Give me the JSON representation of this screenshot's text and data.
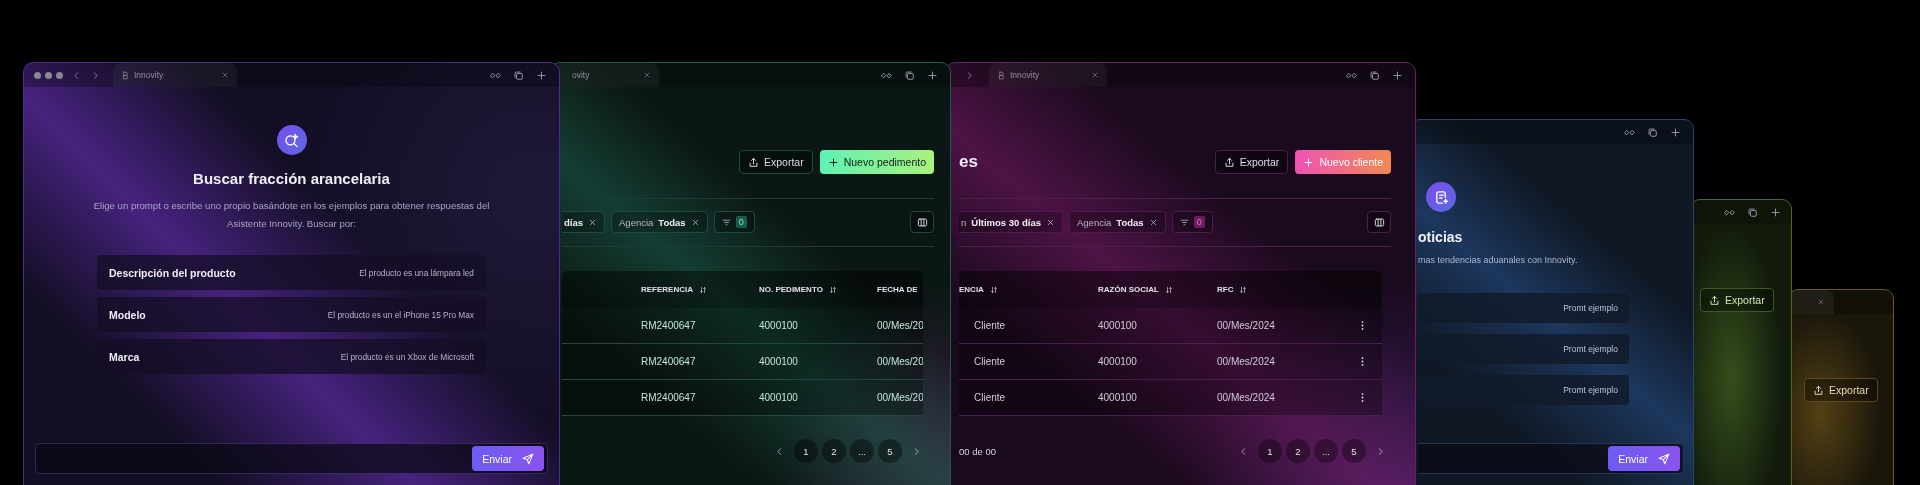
{
  "search_window": {
    "tab": {
      "label": "Innovity"
    },
    "title": "Buscar fracción arancelaria",
    "description": "Elige un prompt o escribe uno propio basándote en los ejemplos para obtener respuestas del Asistente Innovity. Buscar por:",
    "prompts": [
      {
        "label": "Descripción del producto",
        "example": "El producto es una lámpara led"
      },
      {
        "label": "Modelo",
        "example": "El producto es un el iPhone 15 Pro Max"
      },
      {
        "label": "Marca",
        "example": "El producto es un Xbox de Microsoft"
      }
    ],
    "send_button": "Enviar"
  },
  "orders_window": {
    "tab": {
      "label": "ovity"
    },
    "export_button": "Exportar",
    "create_button": "Nuevo pedimento",
    "filters": [
      {
        "value": "días"
      },
      {
        "label": "Agencia",
        "value": "Todas"
      }
    ],
    "filter_count": "0",
    "columns": [
      "REFERENCIA",
      "NO. PEDIMENTO",
      "FECHA DE"
    ],
    "rows": [
      [
        "RM2400647",
        "4000100",
        "00/Mes/20"
      ],
      [
        "RM2400647",
        "4000100",
        "00/Mes/20"
      ],
      [
        "RM2400647",
        "4000100",
        "00/Mes/20"
      ]
    ],
    "pages": [
      "1",
      "2",
      "...",
      "5"
    ]
  },
  "clients_window": {
    "tab": {
      "label": "Innovity"
    },
    "title": "es",
    "export_button": "Exportar",
    "create_button": "Nuevo cliente",
    "filters": [
      {
        "label": "n",
        "value": "Últimos 30 días"
      },
      {
        "label": "Agencia",
        "value": "Todas"
      }
    ],
    "filter_count": "0",
    "columns": [
      "ENCIA",
      "RAZÓN SOCIAL",
      "RFC"
    ],
    "rows": [
      [
        "Cliente",
        "4000100",
        "00/Mes/2024"
      ],
      [
        "Cliente",
        "4000100",
        "00/Mes/2024"
      ],
      [
        "Cliente",
        "4000100",
        "00/Mes/2024"
      ]
    ],
    "footer": "00 de 00",
    "pages": [
      "1",
      "2",
      "...",
      "5"
    ]
  },
  "news_window": {
    "title": "oticias",
    "description": "mas tendencias aduanales con Innovity.",
    "prompts": [
      {
        "example": "Promt ejemplo"
      },
      {
        "example": "Promt ejemplo"
      },
      {
        "example": "Promt ejemplo"
      }
    ],
    "send_button": "Enviar"
  },
  "back_windows": [
    {
      "kind": "toolbar",
      "export_button": "Exportar"
    },
    {
      "kind": "tab",
      "export_button": "Exportar"
    }
  ]
}
